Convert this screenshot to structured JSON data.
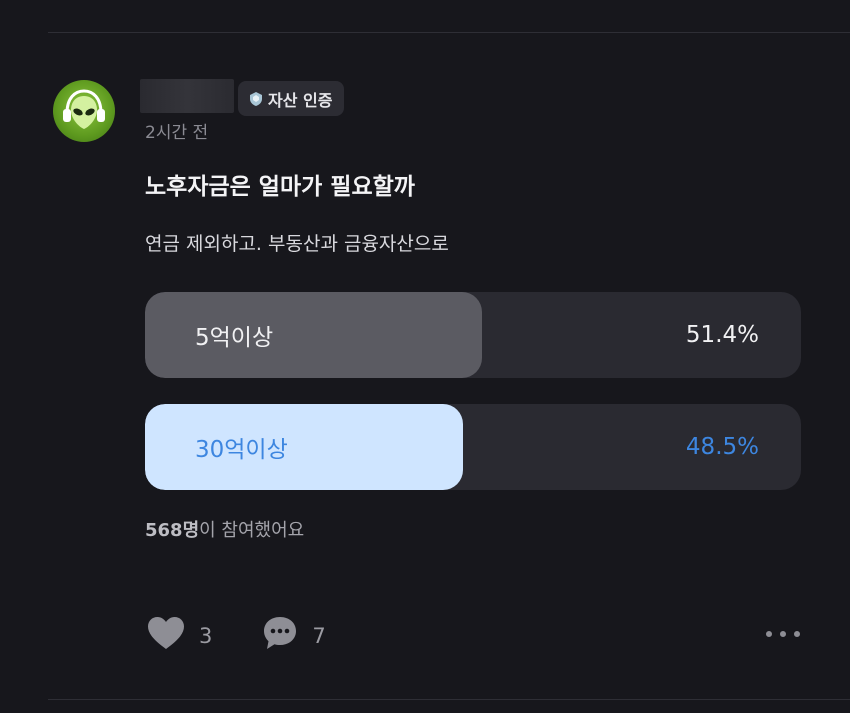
{
  "post": {
    "badge_label": "자산 인증",
    "time": "2시간 전",
    "title": "노후자금은 얼마가 필요할까",
    "body": "연금 제외하고. 부동산과 금융자산으로"
  },
  "poll": {
    "options": [
      {
        "label": "5억이상",
        "percent": "51.4%",
        "value": 51.4
      },
      {
        "label": "30억이상",
        "percent": "48.5%",
        "value": 48.5
      }
    ],
    "participants_count": "568명",
    "participants_suffix": "이 참여했어요"
  },
  "actions": {
    "likes": "3",
    "comments": "7"
  },
  "icons": {
    "avatar": "alien-headphones-avatar",
    "badge": "shield-icon",
    "like": "heart-icon",
    "comment": "chat-bubble-icon",
    "more": "more-dots-icon"
  },
  "colors": {
    "background": "#17171c",
    "option_track": "#2a2a31",
    "option1_fill": "#5b5b62",
    "option2_fill": "#cfe5ff",
    "option2_text": "#3d86e0"
  }
}
